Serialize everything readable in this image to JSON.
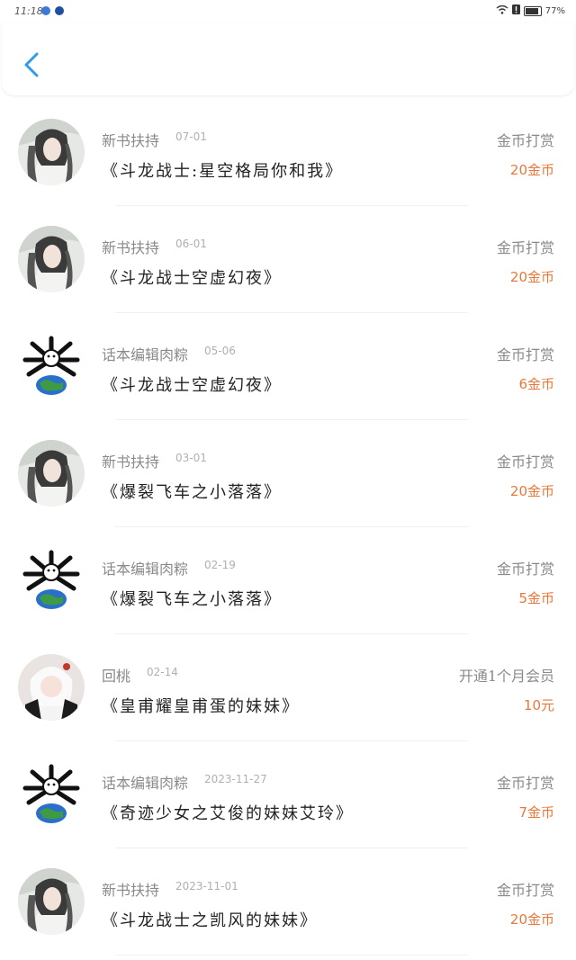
{
  "status_bar": {
    "time": "11:18",
    "battery": "77%"
  },
  "header": {
    "back_icon": "chevron-left-icon",
    "accent": "#2f9ce8"
  },
  "rows": [
    {
      "name": "新书扶持",
      "date": "07-01",
      "title": "《斗龙战士:星空格局你和我》",
      "type": "金币打赏",
      "amount": "20金币",
      "avatar": "portrait"
    },
    {
      "name": "新书扶持",
      "date": "06-01",
      "title": "《斗龙战士空虚幻夜》",
      "type": "金币打赏",
      "amount": "20金币",
      "avatar": "portrait"
    },
    {
      "name": "话本编辑肉粽",
      "date": "05-06",
      "title": "《斗龙战士空虚幻夜》",
      "type": "金币打赏",
      "amount": "6金币",
      "avatar": "globe"
    },
    {
      "name": "新书扶持",
      "date": "03-01",
      "title": "《爆裂飞车之小落落》",
      "type": "金币打赏",
      "amount": "20金币",
      "avatar": "portrait"
    },
    {
      "name": "话本编辑肉粽",
      "date": "02-19",
      "title": "《爆裂飞车之小落落》",
      "type": "金币打赏",
      "amount": "5金币",
      "avatar": "globe"
    },
    {
      "name": "回桃",
      "date": "02-14",
      "title": "《皇甫耀皇甫蛋的妹妹》",
      "type": "开通1个月会员",
      "amount": "10元",
      "avatar": "girl"
    },
    {
      "name": "话本编辑肉粽",
      "date": "2023-11-27",
      "title": "《奇迹少女之艾俊的妹妹艾玲》",
      "type": "金币打赏",
      "amount": "7金币",
      "avatar": "globe"
    },
    {
      "name": "新书扶持",
      "date": "2023-11-01",
      "title": "《斗龙战士之凯风的妹妹》",
      "type": "金币打赏",
      "amount": "20金币",
      "avatar": "portrait"
    }
  ],
  "colors": {
    "amount": "#e8783a",
    "muted": "#8a8a8a",
    "title": "#222222"
  }
}
